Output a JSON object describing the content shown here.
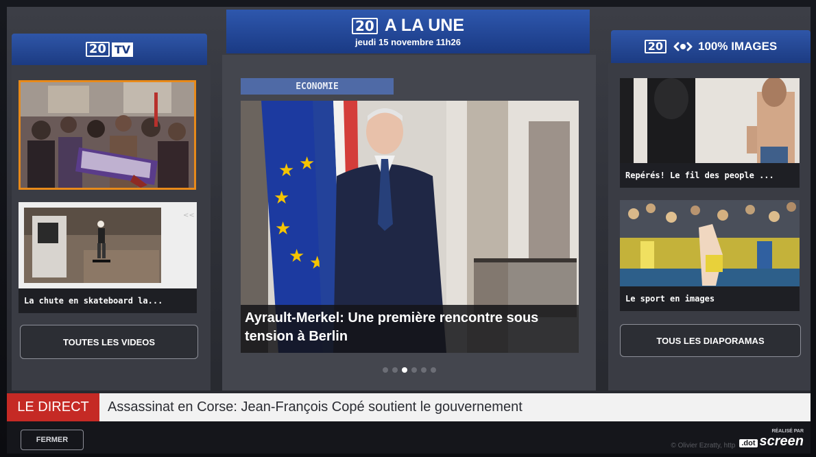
{
  "header": {
    "left_tab": {
      "logo": "20",
      "badge": "TV"
    },
    "center_tab": {
      "logo": "20",
      "title": "A LA UNE",
      "date": "jeudi 15 novembre 11h26"
    },
    "right_tab": {
      "logo": "20",
      "title": "100% IMAGES",
      "icon": "eye-icon"
    }
  },
  "left_panel": {
    "videos": [
      {
        "caption": ""
      },
      {
        "caption": "La chute en skateboard la..."
      }
    ],
    "all_button": "TOUTES LES VIDEOS"
  },
  "center_panel": {
    "category": "ECONOMIE",
    "headline": "Ayrault-Merkel: Une première rencontre sous tension à Berlin",
    "carousel": {
      "count": 6,
      "active": 3
    }
  },
  "right_panel": {
    "galleries": [
      {
        "caption": "Repérés! Le fil des people ..."
      },
      {
        "caption": "Le sport en images"
      }
    ],
    "all_button": "TOUS LES DIAPORAMAS"
  },
  "ticker": {
    "label": "LE DIRECT",
    "text": "Assassinat en Corse: Jean-François Copé soutient le gouvernement"
  },
  "footer": {
    "close_button": "FERMER",
    "copyright": "© Olivier Ezratty, http",
    "made_by": "RÉALISÉ PAR",
    "brand_prefix": ".dot",
    "brand": "screen"
  },
  "colors": {
    "blue": "#1c3b82",
    "orange_highlight": "#e88a1a",
    "ticker_red": "#c52a25"
  }
}
